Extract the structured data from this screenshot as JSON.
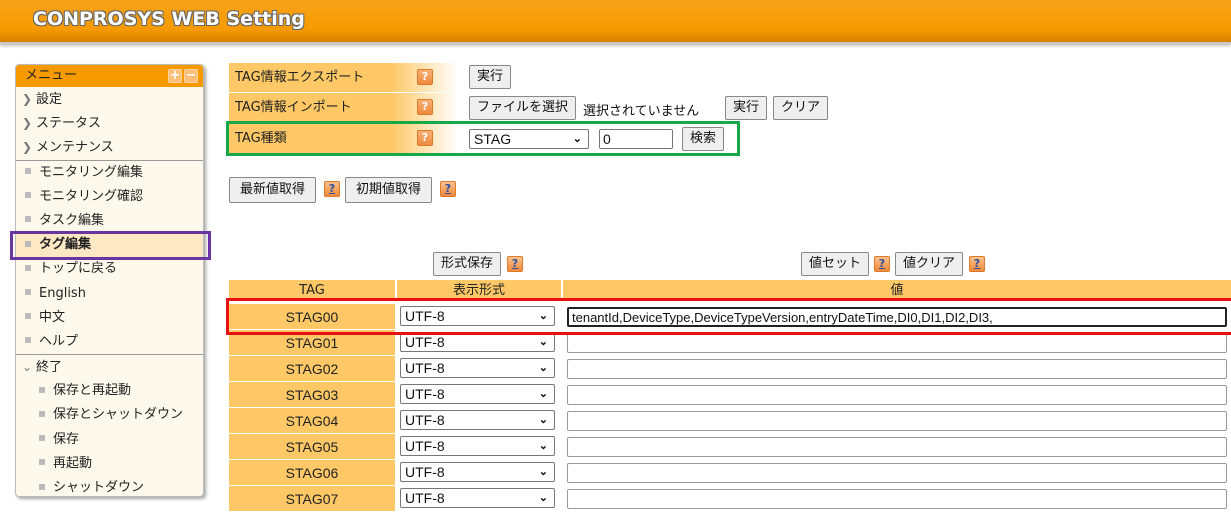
{
  "header": {
    "title": "CONPROSYS WEB Setting"
  },
  "sidebar": {
    "title": "メニュー",
    "expand_all": "+",
    "collapse_all": "−",
    "groups": [
      {
        "label": "設定",
        "icon": "chevron-right"
      },
      {
        "label": "ステータス",
        "icon": "chevron-right"
      },
      {
        "label": "メンテナンス",
        "icon": "chevron-right"
      }
    ],
    "items": [
      {
        "label": "モニタリング編集"
      },
      {
        "label": "モニタリング確認"
      },
      {
        "label": "タスク編集"
      },
      {
        "label": "タグ編集",
        "active": true
      },
      {
        "label": "トップに戻る"
      },
      {
        "label": "English"
      },
      {
        "label": "中文"
      },
      {
        "label": "ヘルプ"
      }
    ],
    "exit_group": {
      "label": "終了",
      "icon": "chevron-down",
      "items": [
        {
          "label": "保存と再起動"
        },
        {
          "label": "保存とシャットダウン"
        },
        {
          "label": "保存"
        },
        {
          "label": "再起動"
        },
        {
          "label": "シャットダウン"
        }
      ]
    }
  },
  "form": {
    "export": {
      "label": "TAG情報エクスポート",
      "help": "?",
      "run": "実行"
    },
    "import": {
      "label": "TAG情報インポート",
      "help": "?",
      "choose_file": "ファイルを選択",
      "no_file": "選択されていません",
      "run": "実行",
      "clear": "クリア"
    },
    "tag_type": {
      "label": "TAG種類",
      "help": "?",
      "selected": "STAG",
      "number": "0",
      "search": "検索"
    },
    "latest_value": "最新値取得",
    "initial_value": "初期値取得",
    "help": "?"
  },
  "table": {
    "save_format": "形式保存",
    "set_value": "値セット",
    "clear_value": "値クリア",
    "help": "?",
    "columns": [
      "TAG",
      "表示形式",
      "値"
    ],
    "rows": [
      {
        "tag": "STAG00",
        "format": "UTF-8",
        "value": "tenantId,DeviceType,DeviceTypeVersion,entryDateTime,DI0,DI1,DI2,DI3,"
      },
      {
        "tag": "STAG01",
        "format": "UTF-8",
        "value": ""
      },
      {
        "tag": "STAG02",
        "format": "UTF-8",
        "value": ""
      },
      {
        "tag": "STAG03",
        "format": "UTF-8",
        "value": ""
      },
      {
        "tag": "STAG04",
        "format": "UTF-8",
        "value": ""
      },
      {
        "tag": "STAG05",
        "format": "UTF-8",
        "value": ""
      },
      {
        "tag": "STAG06",
        "format": "UTF-8",
        "value": ""
      },
      {
        "tag": "STAG07",
        "format": "UTF-8",
        "value": ""
      }
    ]
  },
  "annotation_colors": {
    "sidebar_highlight": "#6a35a0",
    "tag_type_highlight": "#17a84a",
    "row_highlight": "#e81010"
  }
}
